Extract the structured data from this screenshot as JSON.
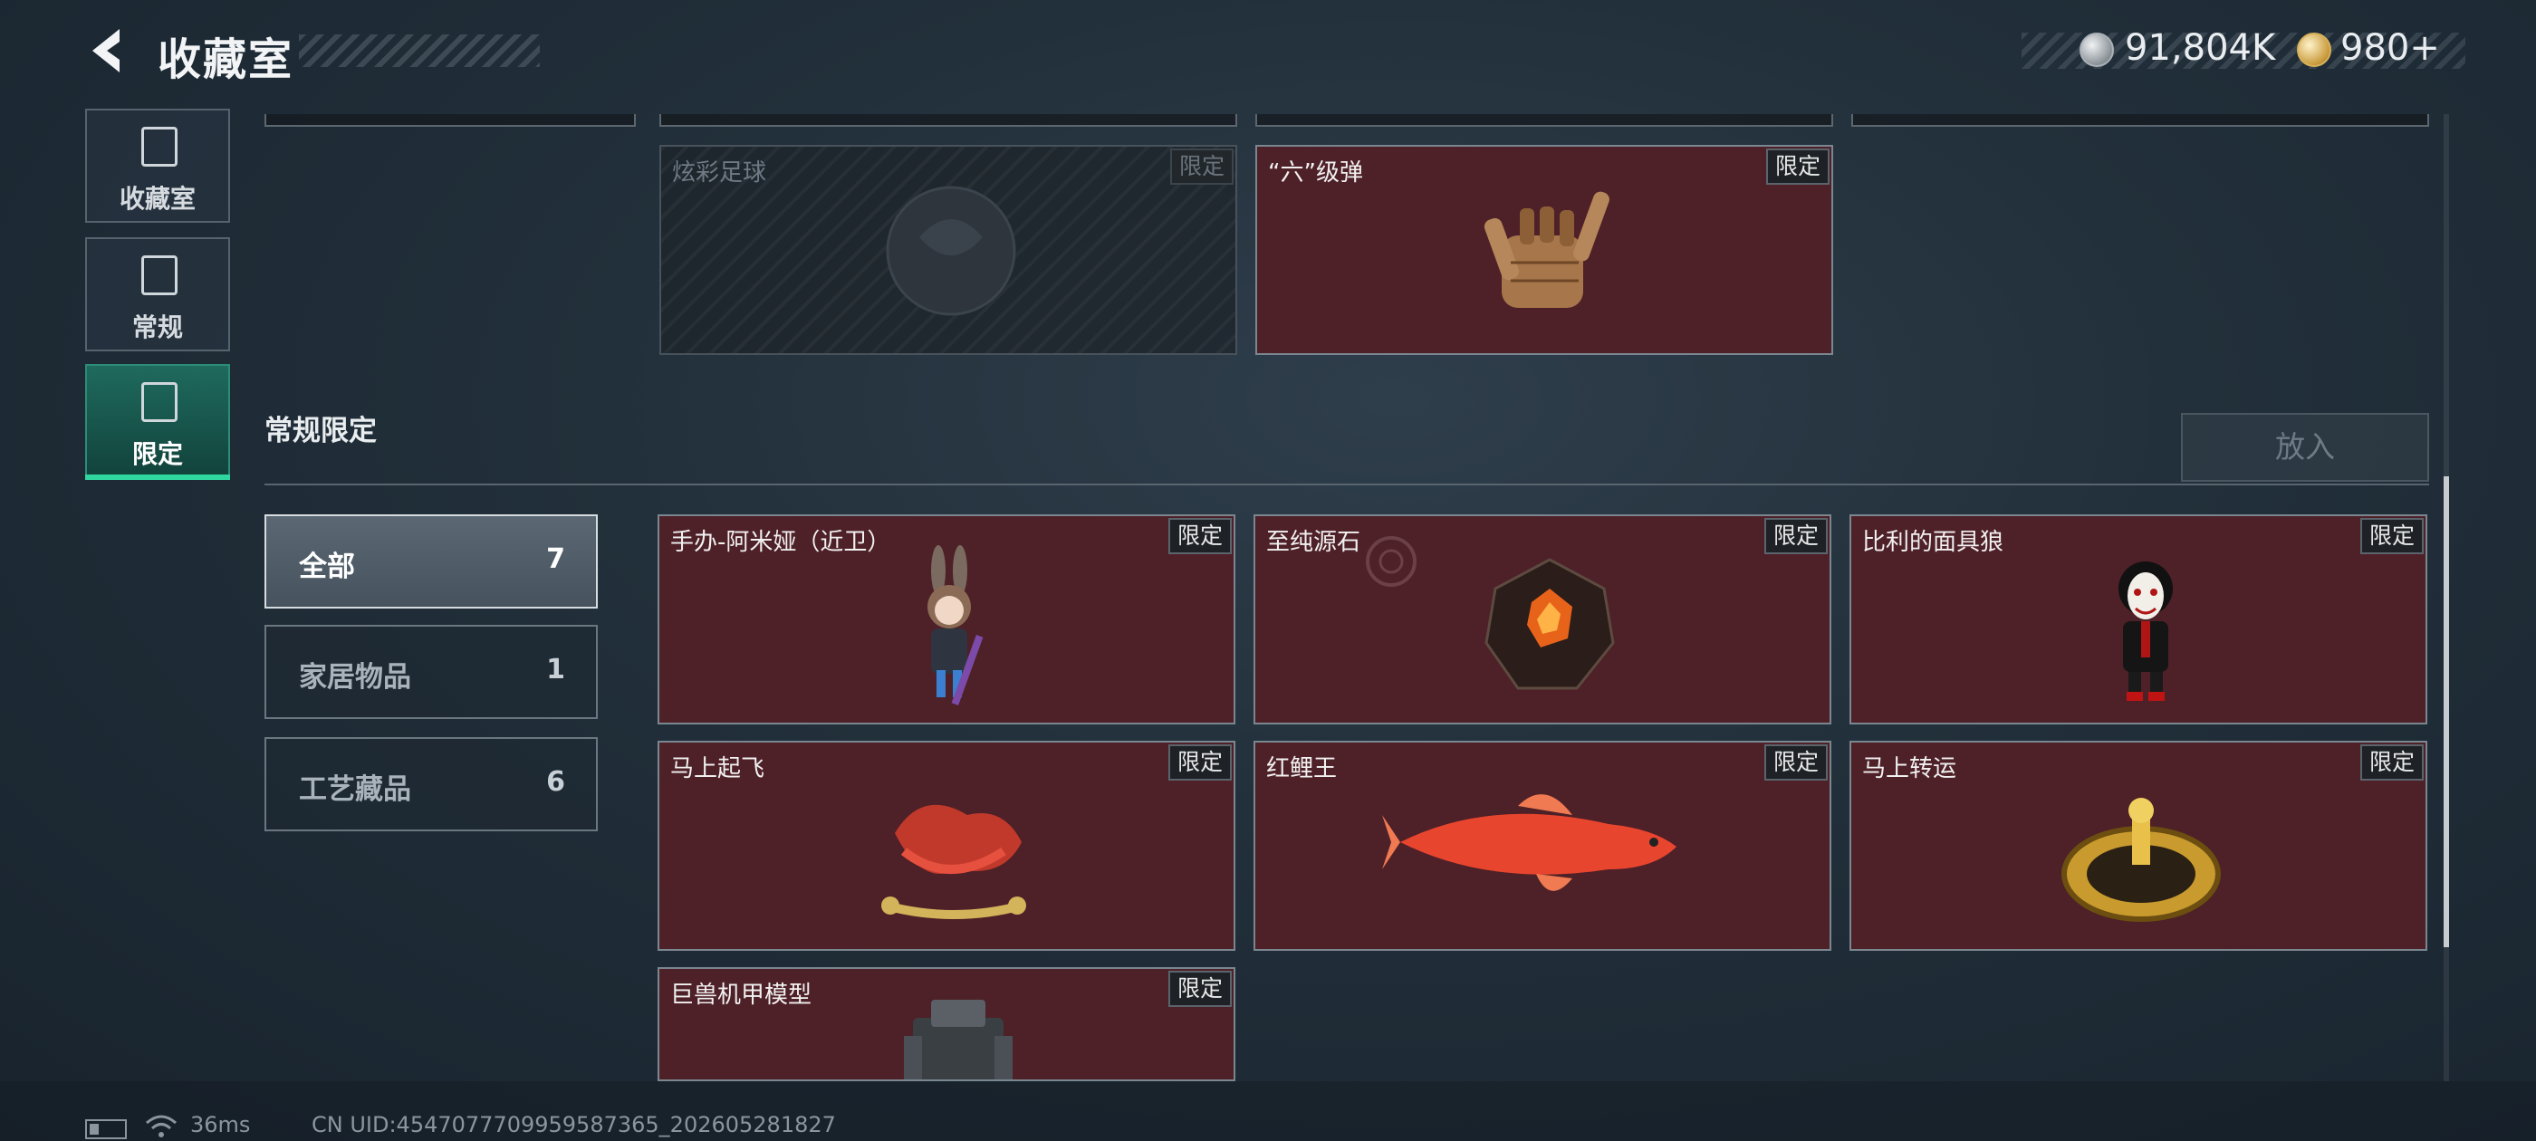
{
  "header": {
    "title": "收藏室",
    "currency_silver": "91,804K",
    "currency_gold": "980",
    "currency_plus": "+"
  },
  "nav": [
    {
      "label": "收藏室",
      "icon": "collection-icon"
    },
    {
      "label": "常规",
      "icon": "regular-icon"
    },
    {
      "label": "限定",
      "icon": "limited-icon",
      "active": true
    }
  ],
  "top_cards": [
    {
      "name": "炫彩足球",
      "tag": "限定",
      "owned": false
    },
    {
      "name": "“六”级弹",
      "tag": "限定",
      "owned": true
    }
  ],
  "section": {
    "title": "常规限定",
    "put_button": "放入"
  },
  "filters": [
    {
      "label": "全部",
      "count": "7",
      "active": true
    },
    {
      "label": "家居物品",
      "count": "1"
    },
    {
      "label": "工艺藏品",
      "count": "6"
    }
  ],
  "items": [
    {
      "name": "手办-阿米娅（近卫）",
      "tag": "限定"
    },
    {
      "name": "至纯源石",
      "tag": "限定"
    },
    {
      "name": "比利的面具狼",
      "tag": "限定"
    },
    {
      "name": "马上起飞",
      "tag": "限定"
    },
    {
      "name": "红鲤王",
      "tag": "限定"
    },
    {
      "name": "马上转运",
      "tag": "限定"
    },
    {
      "name": "巨兽机甲模型",
      "tag": "限定"
    }
  ],
  "footer": {
    "ping": "36ms",
    "uid": "CN UID:4547077709959587365_202605281827"
  },
  "colors": {
    "card_bg": "#4e2027",
    "accent_green": "#2fd6a0",
    "active_nav": "#1f6a5d"
  }
}
